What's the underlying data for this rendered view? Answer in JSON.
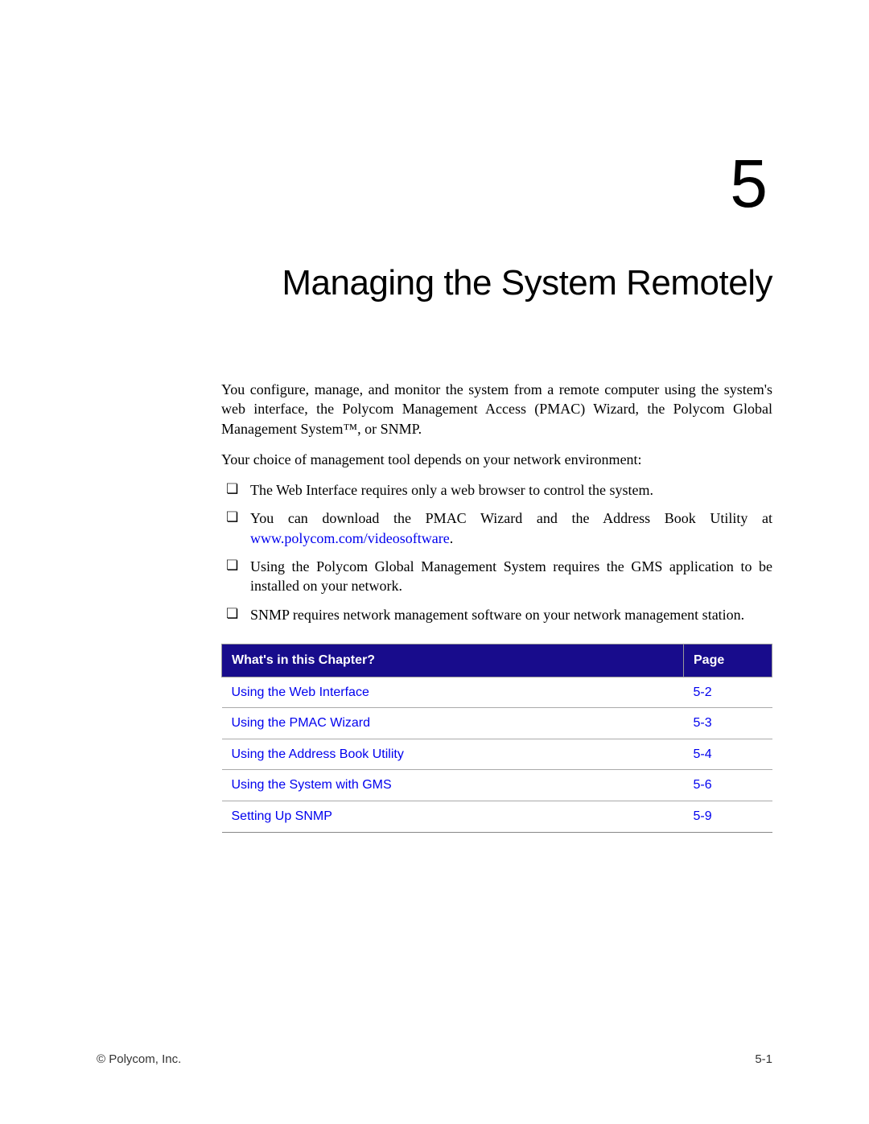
{
  "chapter": {
    "number": "5",
    "title": "Managing the System Remotely"
  },
  "intro": {
    "p1": "You configure, manage, and monitor the system from a remote computer using the system's web interface, the Polycom Management Access (PMAC) Wizard, the Polycom Global Management System™, or SNMP.",
    "p2": "Your choice of management tool depends on your network environment:"
  },
  "bullets": {
    "b1": "The Web Interface requires only a web browser to control the system.",
    "b2_pre": "You can download the PMAC Wizard and the Address Book Utility at ",
    "b2_link": "www.polycom.com/videosoftware",
    "b2_post": ".",
    "b3": "Using the Polycom Global Management System requires the GMS application to be installed on your network.",
    "b4": "SNMP requires network management software on your network management station."
  },
  "toc": {
    "header_title": "What's in this Chapter?",
    "header_page": "Page",
    "rows": [
      {
        "title": "Using the Web Interface",
        "page": "5-2"
      },
      {
        "title": "Using the PMAC Wizard",
        "page": "5-3"
      },
      {
        "title": "Using the Address Book Utility",
        "page": "5-4"
      },
      {
        "title": "Using the System with GMS",
        "page": "5-6"
      },
      {
        "title": "Setting Up SNMP",
        "page": "5-9"
      }
    ]
  },
  "footer": {
    "left": "© Polycom, Inc.",
    "right": "5-1"
  }
}
